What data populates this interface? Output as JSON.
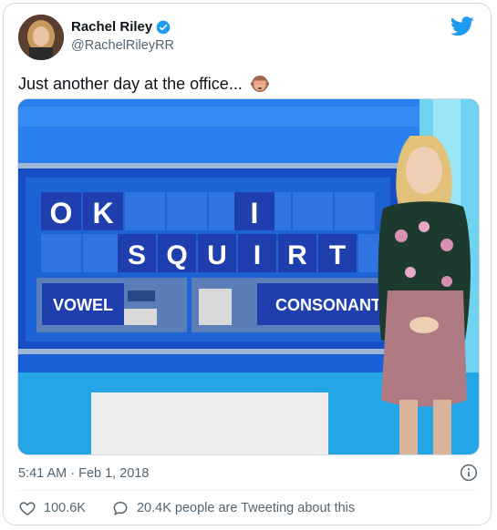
{
  "user": {
    "display_name": "Rachel Riley",
    "handle": "@RachelRileyRR"
  },
  "tweet": {
    "text": "Just another day at the office...",
    "emoji": "see-no-evil-monkey-icon"
  },
  "board": {
    "row1_word1": [
      "O",
      "K"
    ],
    "row1_letter": "I",
    "row2": [
      "S",
      "Q",
      "U",
      "I",
      "R",
      "T"
    ],
    "vowel_label": "VOWEL",
    "consonant_label": "CONSONANT"
  },
  "meta": {
    "timestamp": "5:41 AM · Feb 1, 2018"
  },
  "actions": {
    "likes": "100.6K",
    "replies_text": "20.4K people are Tweeting about this"
  },
  "colors": {
    "twitter_blue": "#1d9bf0",
    "board_blue": "#1a54c9",
    "tile_blue": "#1f3fae"
  }
}
